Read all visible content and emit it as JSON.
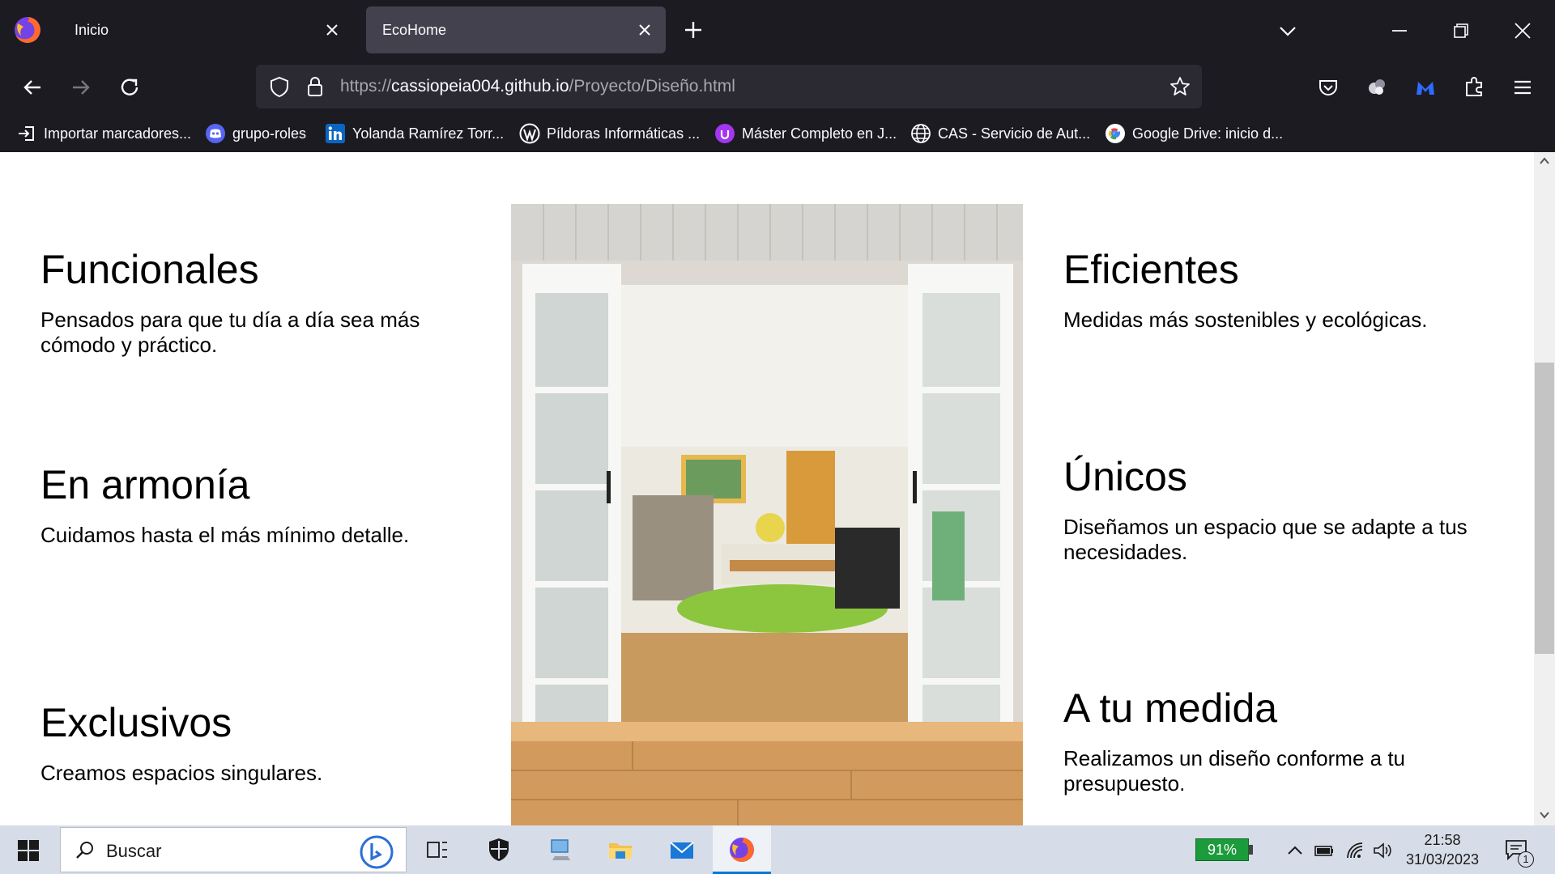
{
  "browser": {
    "tabs": [
      {
        "label": "Inicio",
        "active": false
      },
      {
        "label": "EcoHome",
        "active": true
      }
    ],
    "url": {
      "scheme": "https://",
      "host": "cassiopeia004.github.io",
      "path": "/Proyecto/Diseño.html"
    },
    "bookmarks": [
      {
        "label": "Importar marcadores...",
        "icon": "import-icon"
      },
      {
        "label": "grupo-roles",
        "icon": "discord-icon"
      },
      {
        "label": "Yolanda Ramírez Torr...",
        "icon": "linkedin-icon"
      },
      {
        "label": "Píldoras Informáticas ...",
        "icon": "wordpress-icon"
      },
      {
        "label": "Máster Completo en J...",
        "icon": "udemy-icon"
      },
      {
        "label": "CAS - Servicio de Aut...",
        "icon": "globe-icon"
      },
      {
        "label": "Google Drive: inicio d...",
        "icon": "google-icon"
      }
    ]
  },
  "page": {
    "left_features": [
      {
        "title": "Funcionales",
        "text": "Pensados para que tu día a día sea más cómodo y práctico."
      },
      {
        "title": "En armonía",
        "text": "Cuidamos hasta el más mínimo detalle."
      },
      {
        "title": "Exclusivos",
        "text": "Creamos espacios singulares."
      }
    ],
    "right_features": [
      {
        "title": "Eficientes",
        "text": "Medidas más sostenibles y ecológicas."
      },
      {
        "title": "Únicos",
        "text": "Diseñamos un espacio que se adapte a tus necesidades."
      },
      {
        "title": "A tu medida",
        "text": "Realizamos un diseño conforme a tu presupuesto."
      }
    ]
  },
  "taskbar": {
    "search_placeholder": "Buscar",
    "battery": "91%",
    "time": "21:58",
    "date": "31/03/2023",
    "notifications": "1"
  },
  "colors": {
    "chrome_bg": "#1c1b22",
    "active_tab": "#42414d",
    "urlbar_bg": "#2b2a33",
    "taskbar_bg": "#d7dde8",
    "battery_green": "#1c9b3c"
  }
}
